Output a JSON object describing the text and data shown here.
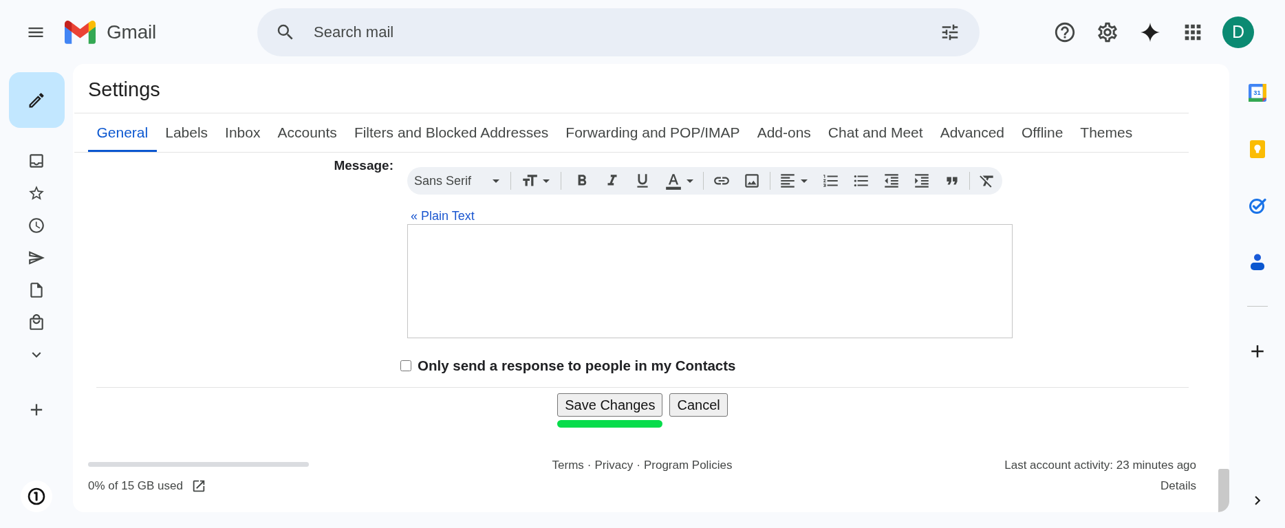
{
  "top_bar": {
    "app_name": "Gmail",
    "search": {
      "placeholder": "Search mail"
    },
    "avatar": {
      "initial": "D"
    }
  },
  "settings": {
    "title": "Settings",
    "tabs": [
      {
        "label": "General",
        "selected": true
      },
      {
        "label": "Labels",
        "selected": false
      },
      {
        "label": "Inbox",
        "selected": false
      },
      {
        "label": "Accounts",
        "selected": false
      },
      {
        "label": "Filters and Blocked Addresses",
        "selected": false
      },
      {
        "label": "Forwarding and POP/IMAP",
        "selected": false
      },
      {
        "label": "Add-ons",
        "selected": false
      },
      {
        "label": "Chat and Meet",
        "selected": false
      },
      {
        "label": "Advanced",
        "selected": false
      },
      {
        "label": "Offline",
        "selected": false
      },
      {
        "label": "Themes",
        "selected": false
      }
    ]
  },
  "message": {
    "label": "Message:",
    "toolbar": {
      "font": "Sans Serif"
    },
    "plain_text_link": "« Plain Text"
  },
  "contacts_only": {
    "label": "Only send a response to people in my Contacts",
    "checked": false
  },
  "buttons": [
    {
      "label": "Save Changes",
      "highlighted": true
    },
    {
      "label": "Cancel",
      "highlighted": false
    }
  ],
  "footer": {
    "storage": {
      "text": "0% of 15 GB used"
    },
    "links": [
      "Terms",
      "Privacy",
      "Program Policies"
    ],
    "separators": [
      "·",
      "·"
    ],
    "activity": "Last account activity: 23 minutes ago",
    "details": "Details"
  },
  "side_panel": {
    "calendar_day": "31"
  }
}
